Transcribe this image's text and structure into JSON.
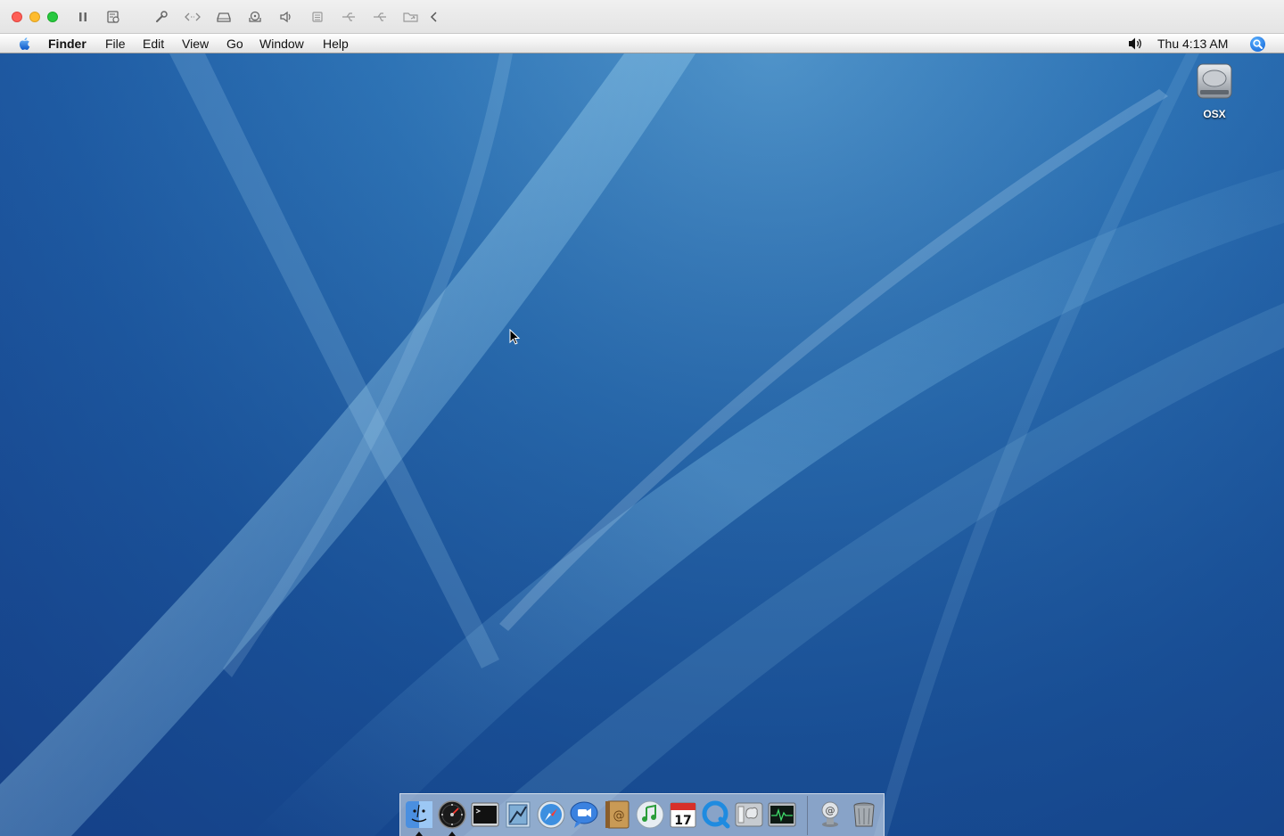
{
  "menubar": {
    "app_name": "Finder",
    "menus": [
      "File",
      "Edit",
      "View",
      "Go",
      "Window",
      "Help"
    ],
    "clock": "Thu 4:13 AM"
  },
  "desktop": {
    "drive_label": "OSX"
  },
  "icons": {
    "host_toolbar": [
      "pause-icon",
      "snapshot-icon",
      "settings-wrench-icon",
      "code-brackets-icon",
      "hard-drive-icon",
      "cdrom-icon",
      "speaker-icon",
      "storage-icon",
      "usb-icon",
      "usb-icon",
      "shared-folder-icon",
      "chevron-left-icon"
    ],
    "dock": [
      "finder-icon",
      "dashboard-icon",
      "terminal-icon",
      "mail-icon",
      "safari-icon",
      "ichat-icon",
      "address-book-icon",
      "itunes-icon",
      "ical-icon",
      "quicktime-icon",
      "system-preferences-icon",
      "activity-monitor-icon",
      "mail-stack-icon",
      "trash-icon"
    ]
  },
  "dock": {
    "ical_date": "17"
  },
  "colors": {
    "traffic_close": "#fe5f57",
    "traffic_min": "#febc2e",
    "traffic_max": "#28c840",
    "desktop_blue": "#1f5ca4",
    "spotlight_blue": "#0a5fd6"
  }
}
